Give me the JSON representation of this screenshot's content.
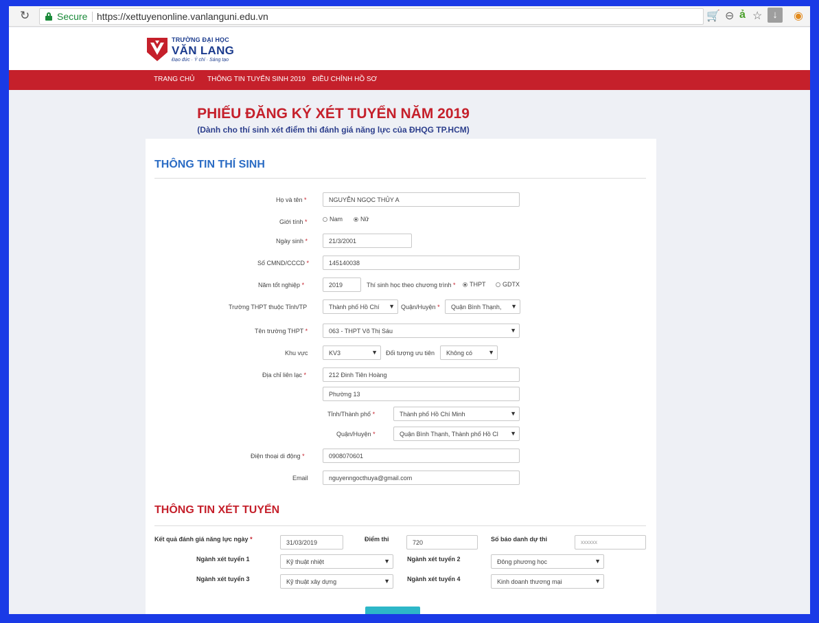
{
  "browser": {
    "secure_label": "Secure",
    "url": "https://xettuyenonline.vanlanguni.edu.vn"
  },
  "logo": {
    "line1": "TRƯỜNG ĐẠI HỌC",
    "line2": "VĂN LANG",
    "tagline": "Đạo đức · Ý chí · Sáng tạo"
  },
  "nav": {
    "items": [
      "TRANG CHỦ",
      "THÔNG TIN TUYỂN SINH 2019",
      "ĐIỀU CHỈNH HỒ SƠ"
    ]
  },
  "page": {
    "title": "PHIẾU ĐĂNG KÝ XÉT TUYỂN NĂM 2019",
    "subtitle": "(Dành cho thí sinh xét điểm thi đánh giá năng lực của ĐHQG TP.HCM)"
  },
  "candidate": {
    "section_title": "THÔNG TIN THÍ SINH",
    "fullname_label": "Họ và tên",
    "fullname_value": "NGUYỄN NGỌC THỦY A",
    "gender_label": "Giới tính",
    "gender_male": "Nam",
    "gender_female": "Nữ",
    "dob_label": "Ngày sinh",
    "dob_value": "21/3/2001",
    "id_label": "Số CMND/CCCD",
    "id_value": "145140038",
    "grad_year_label": "Năm tốt nghiệp",
    "grad_year_value": "2019",
    "program_label": "Thí sinh học theo chương trình",
    "program_thpt": "THPT",
    "program_gdtx": "GDTX",
    "school_province_label": "Trường THPT thuộc Tỉnh/TP",
    "school_province_value": "Thành phố Hồ Chí",
    "school_district_label": "Quận/Huyện",
    "school_district_value": "Quận Bình Thạnh,",
    "school_name_label": "Tên trường THPT",
    "school_name_value": "063 - THPT Võ Thị Sáu",
    "area_label": "Khu vực",
    "area_value": "KV3",
    "priority_label": "Đối tượng ưu tiên",
    "priority_value": "Không có",
    "address_label": "Địa chỉ liên lạc",
    "address_line1": "212 Đinh Tiên Hoàng",
    "address_line2": "Phường 13",
    "addr_province_label": "Tỉnh/Thành phố",
    "addr_province_value": "Thành phố Hồ Chí Minh",
    "addr_district_label": "Quận/Huyện",
    "addr_district_value": "Quận Bình Thạnh, Thành phố Hồ Cl",
    "phone_label": "Điện thoại di động",
    "phone_value": "0908070601",
    "email_label": "Email",
    "email_value": "nguyenngocthuya@gmail.com"
  },
  "admission": {
    "section_title": "THÔNG TIN XÉT TUYỂN",
    "result_date_label": "Kết quả đánh giá năng lực ngày",
    "result_date_value": "31/03/2019",
    "score_label": "Điểm thi",
    "score_value": "720",
    "candidate_no_label": "Số báo danh dự thi",
    "candidate_no_placeholder": "xxxxxx",
    "major1_label": "Ngành xét tuyển 1",
    "major1_value": "Kỹ thuật nhiệt",
    "major2_label": "Ngành xét tuyển 2",
    "major2_value": "Đông phương học",
    "major3_label": "Ngành xét tuyển 3",
    "major3_value": "Kỹ thuật xây dựng",
    "major4_label": "Ngành xét tuyển 4",
    "major4_value": "Kinh doanh thương mại"
  },
  "colors": {
    "brand_red": "#c5202b",
    "section_blue": "#2b6cc4",
    "frame_blue": "#1a3ae6"
  }
}
